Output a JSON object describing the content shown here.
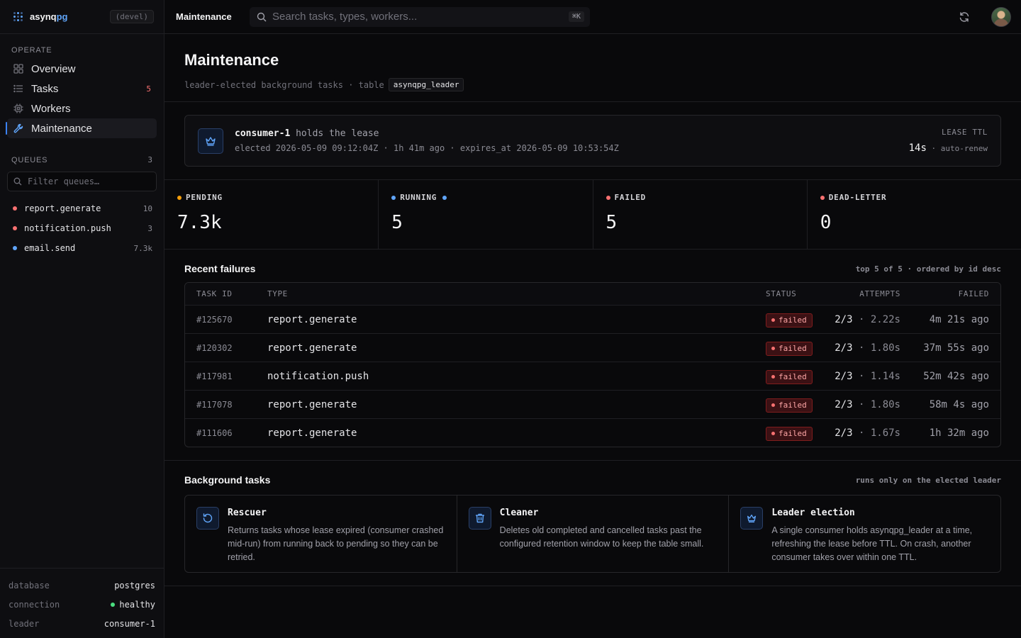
{
  "brand": {
    "name_prefix": "asynq",
    "name_suffix": "pg",
    "env": "(devel)"
  },
  "sidebar": {
    "operate_label": "OPERATE",
    "items": [
      {
        "label": "Overview",
        "icon": "grid-icon",
        "count": ""
      },
      {
        "label": "Tasks",
        "icon": "list-icon",
        "count": "5"
      },
      {
        "label": "Workers",
        "icon": "cpu-icon",
        "count": ""
      },
      {
        "label": "Maintenance",
        "icon": "wrench-icon",
        "count": ""
      }
    ],
    "queues_label": "QUEUES",
    "queues_count": "3",
    "filter_placeholder": "Filter queues…",
    "queues": [
      {
        "name": "report.generate",
        "count": "10",
        "color": "#f87171"
      },
      {
        "name": "notification.push",
        "count": "3",
        "color": "#f87171"
      },
      {
        "name": "email.send",
        "count": "7.3k",
        "color": "#60a5fa"
      }
    ],
    "footer": {
      "database_label": "database",
      "database_value": "postgres",
      "connection_label": "connection",
      "connection_value": "healthy",
      "leader_label": "leader",
      "leader_value": "consumer-1"
    }
  },
  "topbar": {
    "title": "Maintenance",
    "search_placeholder": "Search tasks, types, workers...",
    "search_shortcut": "⌘K"
  },
  "page": {
    "title": "Maintenance",
    "subtitle": "leader-elected background tasks · table",
    "table_name": "asynqpg_leader"
  },
  "lease": {
    "holder": "consumer-1",
    "holds_text": "holds the lease",
    "details": "elected 2026-05-09 09:12:04Z · 1h 41m ago · expires_at 2026-05-09 10:53:54Z",
    "ttl_label": "LEASE TTL",
    "ttl_value": "14s",
    "ttl_note": "· auto-renew"
  },
  "stats": [
    {
      "label": "PENDING",
      "value": "7.3k",
      "color": "#f59e0b"
    },
    {
      "label": "RUNNING",
      "value": "5",
      "color": "#60a5fa"
    },
    {
      "label": "FAILED",
      "value": "5",
      "color": "#f87171"
    },
    {
      "label": "DEAD-LETTER",
      "value": "0",
      "color": "#f87171"
    }
  ],
  "failures": {
    "title": "Recent failures",
    "note": "top 5 of 5 · ordered by id desc",
    "columns": {
      "id": "TASK ID",
      "type": "TYPE",
      "status": "STATUS",
      "attempts": "ATTEMPTS",
      "failed": "FAILED"
    },
    "rows": [
      {
        "id": "#125670",
        "type": "report.generate",
        "status": "failed",
        "attempts": "2/3",
        "duration": "· 2.22s",
        "failed": "4m 21s ago"
      },
      {
        "id": "#120302",
        "type": "report.generate",
        "status": "failed",
        "attempts": "2/3",
        "duration": "· 1.80s",
        "failed": "37m 55s ago"
      },
      {
        "id": "#117981",
        "type": "notification.push",
        "status": "failed",
        "attempts": "2/3",
        "duration": "· 1.14s",
        "failed": "52m 42s ago"
      },
      {
        "id": "#117078",
        "type": "report.generate",
        "status": "failed",
        "attempts": "2/3",
        "duration": "· 1.80s",
        "failed": "58m 4s ago"
      },
      {
        "id": "#111606",
        "type": "report.generate",
        "status": "failed",
        "attempts": "2/3",
        "duration": "· 1.67s",
        "failed": "1h 32m ago"
      }
    ]
  },
  "background": {
    "title": "Background tasks",
    "note": "runs only on the elected leader",
    "cards": [
      {
        "title": "Rescuer",
        "icon": "rotate-ccw-icon",
        "desc": "Returns tasks whose lease expired (consumer crashed mid-run) from running back to pending so they can be retried."
      },
      {
        "title": "Cleaner",
        "icon": "trash-icon",
        "desc": "Deletes old completed and cancelled tasks past the configured retention window to keep the table small."
      },
      {
        "title": "Leader election",
        "icon": "crown-icon",
        "desc": "A single consumer holds asynqpg_leader at a time, refreshing the lease before TTL. On crash, another consumer takes over within one TTL."
      }
    ]
  }
}
